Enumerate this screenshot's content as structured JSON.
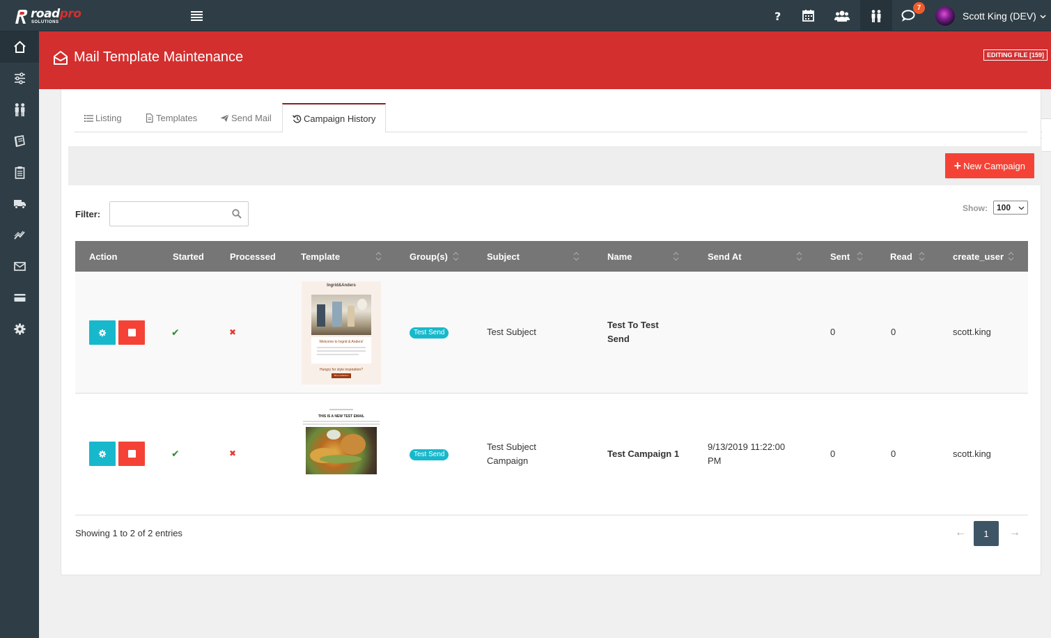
{
  "brand": {
    "name_a": "road",
    "name_b": "pro",
    "sub": "SOLUTIONS"
  },
  "topbar": {
    "icons": [
      "help-icon",
      "calendar-icon",
      "users-icon",
      "people-icon",
      "chat-icon"
    ],
    "chat_badge": "7",
    "user_name": "Scott King (DEV)"
  },
  "sidebar": {
    "items": [
      "home-icon",
      "sliders-icon",
      "people-icon",
      "book-icon",
      "clipboard-icon",
      "truck-icon",
      "chart-icon",
      "mail-icon",
      "card-icon",
      "gear-icon"
    ]
  },
  "header": {
    "title": "Mail Template Maintenance",
    "edit_badge": "EDITING FILE [159]"
  },
  "tabs": [
    {
      "label": "Listing",
      "icon": "list-icon"
    },
    {
      "label": "Templates",
      "icon": "file-icon"
    },
    {
      "label": "Send Mail",
      "icon": "paper-plane-icon"
    },
    {
      "label": "Campaign History",
      "icon": "history-icon",
      "active": true
    }
  ],
  "toolbar": {
    "new_label": "New Campaign"
  },
  "filter": {
    "label": "Filter:",
    "value": "",
    "placeholder": ""
  },
  "show": {
    "label": "Show:",
    "value": "100"
  },
  "table": {
    "columns": [
      "Action",
      "Started",
      "Processed",
      "Template",
      "Group(s)",
      "Subject",
      "Name",
      "Send At",
      "Sent",
      "Read",
      "create_user"
    ],
    "rows": [
      {
        "started": "✔",
        "processed": "✖",
        "group": "Test Send",
        "subject": "Test Subject",
        "name": "Test To Test Send",
        "send_at": "",
        "sent": "0",
        "read": "0",
        "user": "scott.king",
        "thumb": {
          "brand": "Ingrid&Anders",
          "welcome": "Welcome to Ingrid & Anders!",
          "cta": "Hungry for style inspiration?",
          "button": "Shop Collection"
        }
      },
      {
        "started": "✔",
        "processed": "✖",
        "group": "Test Send",
        "subject": "Test Subject Campaign",
        "name": "Test Campaign 1",
        "send_at": "9/13/2019 11:22:00 PM",
        "sent": "0",
        "read": "0",
        "user": "scott.king",
        "thumb": {
          "headline": "THIS IS A NEW TEST EMAIL"
        }
      }
    ]
  },
  "footer": {
    "showing": "Showing 1 to 2 of 2 entries",
    "page": "1",
    "prev": "←",
    "next": "→"
  },
  "colors": {
    "header_red": "#d32f2f",
    "sidebar": "#2f3e46",
    "accent_cyan": "#18b8cc",
    "danger": "#f44336"
  }
}
